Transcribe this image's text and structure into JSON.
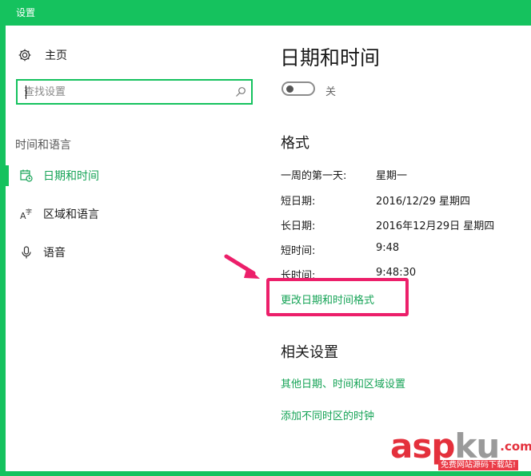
{
  "window": {
    "title": "设置"
  },
  "sidebar": {
    "home_label": "主页",
    "search_placeholder": "查找设置",
    "section_label": "时间和语言",
    "items": [
      {
        "label": "日期和时间",
        "icon": "calendar-clock-icon",
        "active": true
      },
      {
        "label": "区域和语言",
        "icon": "language-icon",
        "active": false
      },
      {
        "label": "语音",
        "icon": "microphone-icon",
        "active": false
      }
    ]
  },
  "main": {
    "title": "日期和时间",
    "toggle": {
      "state_label": "关",
      "on": false
    },
    "format": {
      "heading": "格式",
      "rows": [
        {
          "label": "一周的第一天:",
          "value": "星期一"
        },
        {
          "label": "短日期:",
          "value": "2016/12/29 星期四"
        },
        {
          "label": "长日期:",
          "value": "2016年12月29日 星期四"
        },
        {
          "label": "短时间:",
          "value": "9:48"
        },
        {
          "label": "长时间:",
          "value": "9:48:30"
        }
      ],
      "change_link": "更改日期和时间格式"
    },
    "related": {
      "heading": "相关设置",
      "links": [
        {
          "label": "其他日期、时间和区域设置"
        },
        {
          "label": "添加不同时区的时钟"
        }
      ]
    }
  },
  "annotation": {
    "highlight_color": "#ec1f6a"
  },
  "watermark": {
    "asp": "asp",
    "ku": "ku",
    "com": ".com",
    "sub": "免费网站源码下载站!"
  },
  "colors": {
    "accent": "#15c25e",
    "link": "#15a356"
  }
}
